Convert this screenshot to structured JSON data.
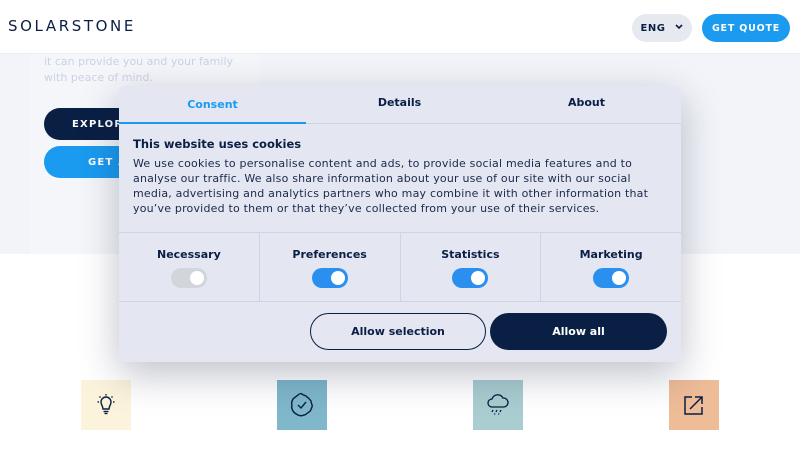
{
  "header": {
    "logo": "SOLARSTONE",
    "language": "ENG",
    "language_chevron": "⌄",
    "cta": "GET QUOTE"
  },
  "hero": {
    "text": "it can provide you and your family with peace of mind.",
    "explore_label": "EXPLORE",
    "get_label": "GET A"
  },
  "tiles": [
    {
      "icon": "lightbulb-icon",
      "color": "#fbf3dc"
    },
    {
      "icon": "badge-check-icon",
      "color": "#7fb7cb"
    },
    {
      "icon": "cloud-rain-icon",
      "color": "#a9cdd0"
    },
    {
      "icon": "external-link-icon",
      "color": "#efbc98"
    }
  ],
  "dialog": {
    "tabs": [
      {
        "label": "Consent",
        "active": true
      },
      {
        "label": "Details",
        "active": false
      },
      {
        "label": "About",
        "active": false
      }
    ],
    "title": "This website uses cookies",
    "body": "We use cookies to personalise content and ads, to provide social media features and to analyse our traffic. We also share information about your use of our site with our social media, advertising and analytics partners who may combine it with other information that you’ve provided to them or that they’ve collected from your use of their services.",
    "categories": [
      {
        "label": "Necessary",
        "enabled": true,
        "locked": true
      },
      {
        "label": "Preferences",
        "enabled": true
      },
      {
        "label": "Statistics",
        "enabled": true
      },
      {
        "label": "Marketing",
        "enabled": true
      }
    ],
    "allow_selection": "Allow selection",
    "allow_all": "Allow all"
  },
  "colors": {
    "primary": "#0a1f44",
    "accent": "#1a9bf0",
    "toggle_on": "#2b8ff0"
  }
}
